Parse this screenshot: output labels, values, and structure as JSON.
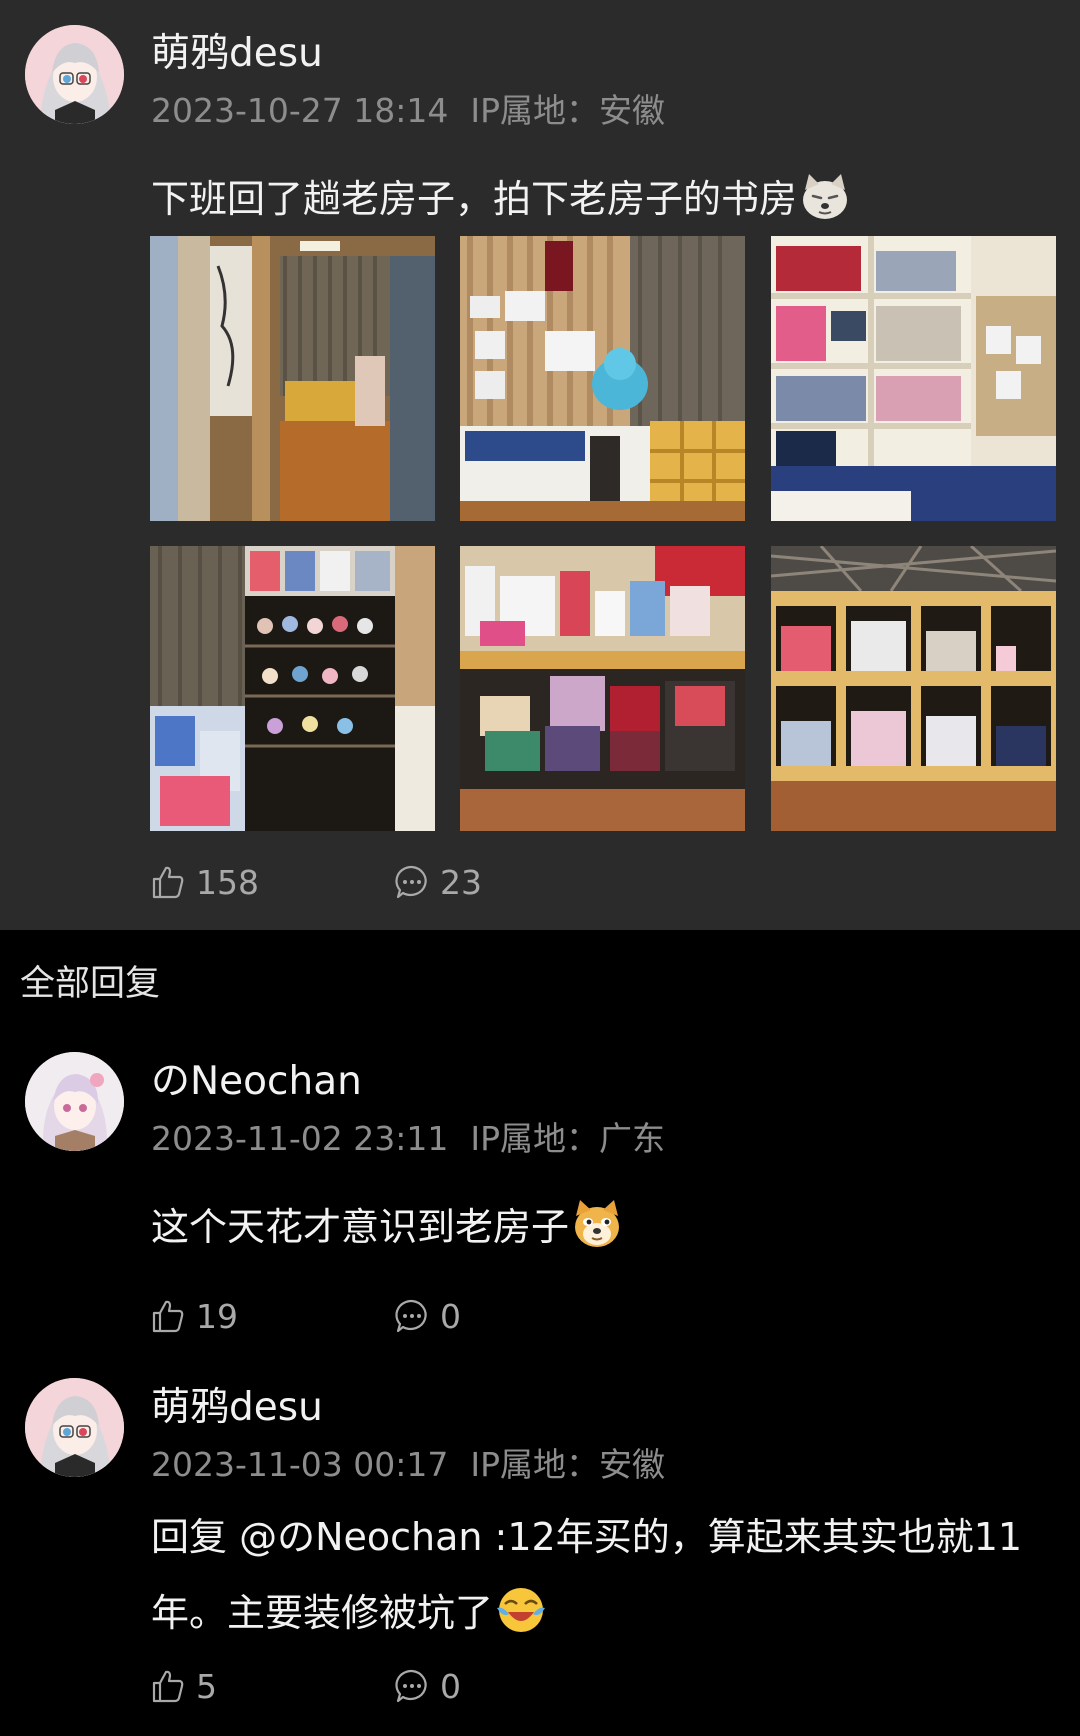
{
  "post": {
    "author": "萌鸦desu",
    "time": "2023-10-27 18:14",
    "ip": "IP属地：安徽",
    "text": "下班回了趟老房子，拍下老房子的书房",
    "emoji": "dog-face",
    "likes": "158",
    "comments": "23",
    "images": [
      "hallway-photo",
      "desk-photo",
      "shelf-photo",
      "cabinet-photo",
      "desk-boxes-photo",
      "bookshelf-photo"
    ]
  },
  "replies_header": "全部回复",
  "replies": [
    {
      "author": "のNeochan",
      "time": "2023-11-02 23:11",
      "ip": "IP属地：广东",
      "text": "这个天花才意识到老房子",
      "emoji": "doge",
      "likes": "19",
      "comments": "0"
    },
    {
      "author": "萌鸦desu",
      "time": "2023-11-03 00:17",
      "ip": "IP属地：安徽",
      "text_line1": "回复 @のNeochan :12年买的，算起来其实也就11",
      "text_line2": "年。主要装修被坑了",
      "emoji": "laughing-tears",
      "likes": "5",
      "comments": "0"
    }
  ],
  "colors": {
    "post_bg": "#2b2b2b",
    "page_bg": "#000000",
    "meta": "#8d8d8d"
  }
}
